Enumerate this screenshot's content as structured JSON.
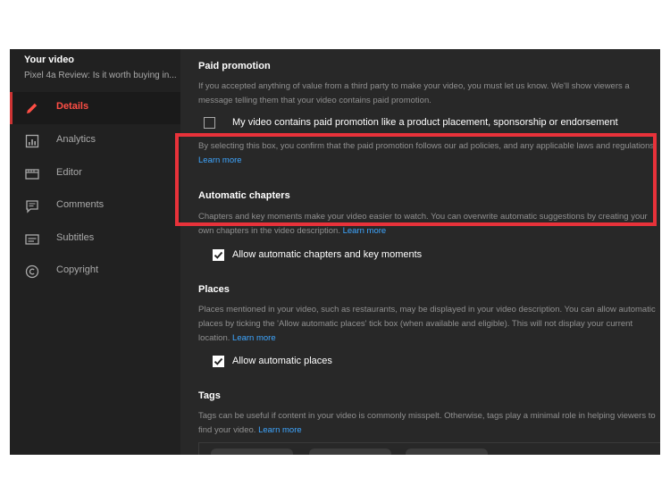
{
  "sidebar": {
    "title": "Your video",
    "subtitle": "Pixel 4a Review: Is it worth buying in...",
    "items": [
      {
        "label": "Details",
        "icon": "pencil-icon",
        "active": true
      },
      {
        "label": "Analytics",
        "icon": "analytics-icon"
      },
      {
        "label": "Editor",
        "icon": "editor-icon"
      },
      {
        "label": "Comments",
        "icon": "comments-icon"
      },
      {
        "label": "Subtitles",
        "icon": "subtitles-icon"
      },
      {
        "label": "Copyright",
        "icon": "copyright-icon"
      }
    ]
  },
  "paid_promotion": {
    "heading": "Paid promotion",
    "description": "If you accepted anything of value from a third party to make your video, you must let us know. We'll show viewers a message telling them that your video contains paid promotion.",
    "checkbox_label": "My video contains paid promotion like a product placement, sponsorship or endorsement",
    "checked": false,
    "note": "By selecting this box, you confirm that the paid promotion follows our ad policies, and any applicable laws and regulations.",
    "learn_more": "Learn more"
  },
  "automatic_chapters": {
    "heading": "Automatic chapters",
    "description": "Chapters and key moments make your video easier to watch. You can overwrite automatic suggestions by creating your own chapters in the video description.",
    "learn_more": "Learn more",
    "checkbox_label": "Allow automatic chapters and key moments",
    "checked": true
  },
  "places": {
    "heading": "Places",
    "description": "Places mentioned in your video, such as restaurants, may be displayed in your video description. You can allow automatic places by ticking the 'Allow automatic places' tick box (when available and eligible). This will not display your current location.",
    "learn_more": "Learn more",
    "checkbox_label": "Allow automatic places",
    "checked": true
  },
  "tags": {
    "heading": "Tags",
    "description": "Tags can be useful if content in your video is commonly misspelt. Otherwise, tags play a minimal role in helping viewers to find your video.",
    "learn_more": "Learn more"
  },
  "colors": {
    "highlight": "#e8323a",
    "accent": "#ff4e45",
    "link": "#3ea6ff"
  }
}
